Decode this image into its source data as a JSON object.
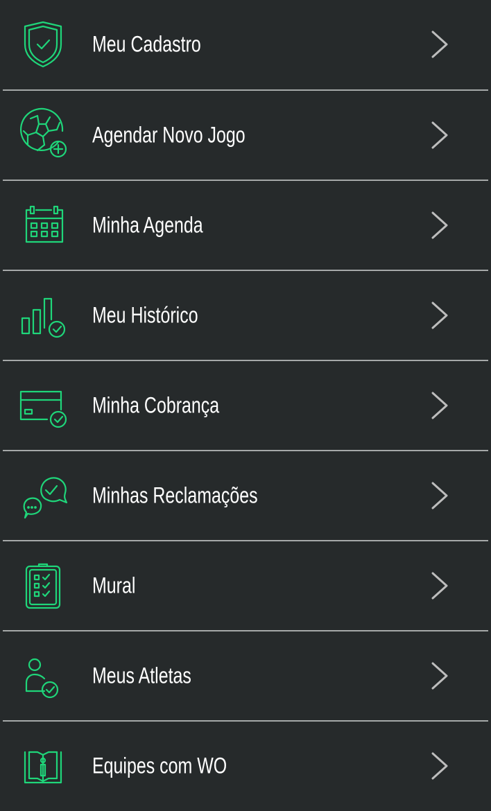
{
  "colors": {
    "background": "#262a2b",
    "accent": "#1fd67a",
    "text": "#ffffff",
    "chevron": "#bdbdbd",
    "divider": "#a6a9a9"
  },
  "menu": {
    "items": [
      {
        "label": "Meu Cadastro",
        "icon": "shield-check-icon"
      },
      {
        "label": "Agendar Novo Jogo",
        "icon": "soccer-ball-plus-icon"
      },
      {
        "label": "Minha Agenda",
        "icon": "calendar-icon"
      },
      {
        "label": "Meu Histórico",
        "icon": "bar-chart-check-icon"
      },
      {
        "label": "Minha Cobrança",
        "icon": "credit-card-check-icon"
      },
      {
        "label": "Minhas Reclamações",
        "icon": "chat-bubbles-check-icon"
      },
      {
        "label": "Mural",
        "icon": "clipboard-checklist-icon"
      },
      {
        "label": "Meus Atletas",
        "icon": "user-check-icon"
      },
      {
        "label": "Equipes com WO",
        "icon": "book-info-icon"
      }
    ]
  }
}
